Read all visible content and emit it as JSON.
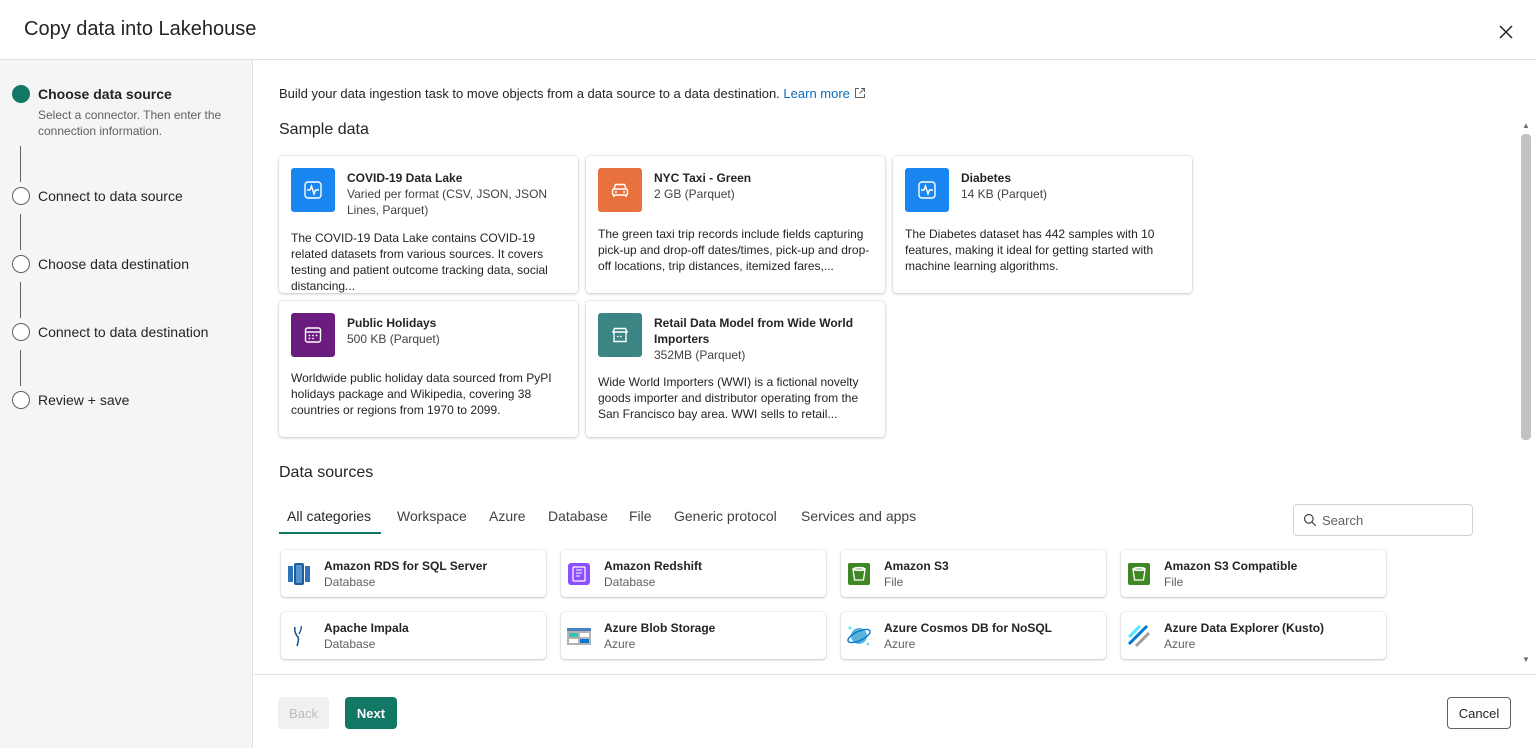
{
  "dialog": {
    "title": "Copy data into Lakehouse"
  },
  "steps": [
    {
      "label": "Choose data source",
      "description": "Select a connector. Then enter the connection information.",
      "active": true
    },
    {
      "label": "Connect to data source"
    },
    {
      "label": "Choose data destination"
    },
    {
      "label": "Connect to data destination"
    },
    {
      "label": "Review + save"
    }
  ],
  "intro": {
    "text": "Build your data ingestion task to move objects from a data source to a data destination.",
    "link": "Learn more"
  },
  "sample_data": {
    "title": "Sample data",
    "cards": [
      {
        "name": "COVID-19 Data Lake",
        "meta": "Varied per format (CSV, JSON, JSON Lines, Parquet)",
        "description": "The COVID-19 Data Lake contains COVID-19 related datasets from various sources. It covers testing and patient outcome tracking data, social distancing...",
        "icon": "health-monitor-icon",
        "color": "#1a86f0"
      },
      {
        "name": "NYC Taxi - Green",
        "meta": "2 GB (Parquet)",
        "description": "The green taxi trip records include fields capturing pick-up and drop-off dates/times, pick-up and drop-off locations, trip distances, itemized fares,...",
        "icon": "car-icon",
        "color": "#e8723e"
      },
      {
        "name": "Diabetes",
        "meta": "14 KB (Parquet)",
        "description": "The Diabetes dataset has 442 samples with 10 features, making it ideal for getting started with machine learning algorithms.",
        "icon": "health-monitor-icon",
        "color": "#1a86f0"
      },
      {
        "name": "Public Holidays",
        "meta": "500 KB (Parquet)",
        "description": "Worldwide public holiday data sourced from PyPI holidays package and Wikipedia, covering 38 countries or regions from 1970 to 2099.",
        "icon": "calendar-icon",
        "color": "#6b1d7f"
      },
      {
        "name": "Retail Data Model from Wide World Importers",
        "meta": "352MB (Parquet)",
        "description": "Wide World Importers (WWI) is a fictional novelty goods importer and distributor operating from the San Francisco bay area. WWI sells to retail...",
        "icon": "store-icon",
        "color": "#3c8585"
      }
    ]
  },
  "data_sources": {
    "title": "Data sources",
    "tabs": [
      "All categories",
      "Workspace",
      "Azure",
      "Database",
      "File",
      "Generic protocol",
      "Services and apps"
    ],
    "search_placeholder": "Search",
    "connectors": [
      {
        "name": "Amazon RDS for SQL Server",
        "category": "Database",
        "icon": "amazon-rds-icon"
      },
      {
        "name": "Amazon Redshift",
        "category": "Database",
        "icon": "amazon-redshift-icon"
      },
      {
        "name": "Amazon S3",
        "category": "File",
        "icon": "amazon-s3-icon"
      },
      {
        "name": "Amazon S3 Compatible",
        "category": "File",
        "icon": "amazon-s3-compatible-icon"
      },
      {
        "name": "Apache Impala",
        "category": "Database",
        "icon": "apache-impala-icon"
      },
      {
        "name": "Azure Blob Storage",
        "category": "Azure",
        "icon": "azure-blob-storage-icon"
      },
      {
        "name": "Azure Cosmos DB for NoSQL",
        "category": "Azure",
        "icon": "azure-cosmos-db-icon"
      },
      {
        "name": "Azure Data Explorer (Kusto)",
        "category": "Azure",
        "icon": "azure-data-explorer-icon"
      }
    ]
  },
  "footer": {
    "back": "Back",
    "next": "Next",
    "cancel": "Cancel"
  },
  "colors": {
    "accent": "#117865",
    "link": "#0f6cbd"
  }
}
